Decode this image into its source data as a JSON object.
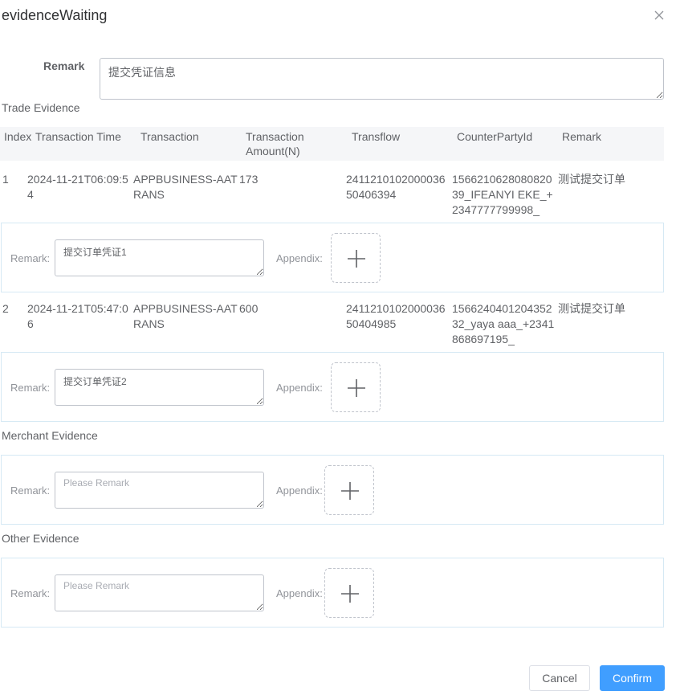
{
  "dialog": {
    "title": "evidenceWaiting",
    "close_icon": "close-icon"
  },
  "remark": {
    "label": "Remark",
    "value": "提交凭证信息"
  },
  "trade_evidence": {
    "title": "Trade Evidence",
    "columns": [
      "Index",
      "Transaction Time",
      "Transaction",
      "Transaction Amount(N)",
      "Transflow",
      "CounterPartyId",
      "Remark"
    ],
    "rows": [
      {
        "index": "1",
        "time": "2024-11-21T06:09:54",
        "transaction": "APPBUSINESS-AATRANS",
        "amount": "173",
        "transflow": "241121010200003650406394",
        "counterparty": "156621062808082039_IFEANYI EKE_+2347777799998_",
        "remark": "测试提交订单",
        "evidence_remark_label": "Remark:",
        "evidence_remark_value": "提交订单凭证1",
        "appendix_label": "Appendix:"
      },
      {
        "index": "2",
        "time": "2024-11-21T05:47:06",
        "transaction": "APPBUSINESS-AATRANS",
        "amount": "600",
        "transflow": "241121010200003650404985",
        "counterparty": "156624040120435232_yaya aaa_+2341868697195_",
        "remark": "测试提交订单",
        "evidence_remark_label": "Remark:",
        "evidence_remark_value": "提交订单凭证2",
        "appendix_label": "Appendix:"
      }
    ]
  },
  "merchant_evidence": {
    "title": "Merchant Evidence",
    "remark_label": "Remark:",
    "remark_placeholder": "Please Remark",
    "appendix_label": "Appendix:"
  },
  "other_evidence": {
    "title": "Other Evidence",
    "remark_label": "Remark:",
    "remark_placeholder": "Please Remark",
    "appendix_label": "Appendix:"
  },
  "footer": {
    "cancel": "Cancel",
    "confirm": "Confirm"
  },
  "colors": {
    "primary": "#409eff",
    "border": "#d6e9f4",
    "header_bg": "#f5f6f8"
  }
}
